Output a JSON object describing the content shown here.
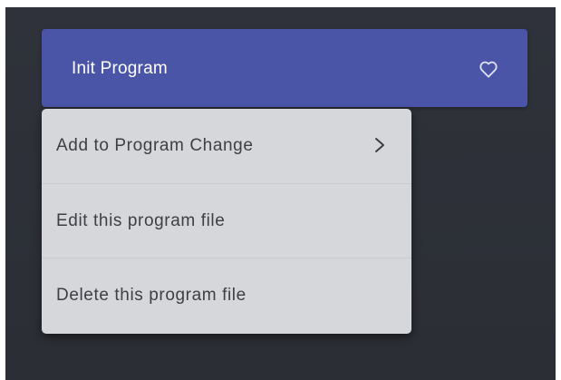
{
  "program": {
    "title": "Init Program",
    "favorite_icon": "heart-outline-icon"
  },
  "context_menu": {
    "items": [
      {
        "label": "Add to Program Change",
        "has_submenu": true,
        "submenu_icon": "chevron-right-icon"
      },
      {
        "label": "Edit this program file",
        "has_submenu": false
      },
      {
        "label": "Delete this program file",
        "has_submenu": false
      }
    ]
  },
  "colors": {
    "background": "#2e3138",
    "program_item": "#4a55a8",
    "menu_background": "#d6d7db",
    "menu_text": "#3d3f45",
    "menu_divider": "#c9cace"
  }
}
